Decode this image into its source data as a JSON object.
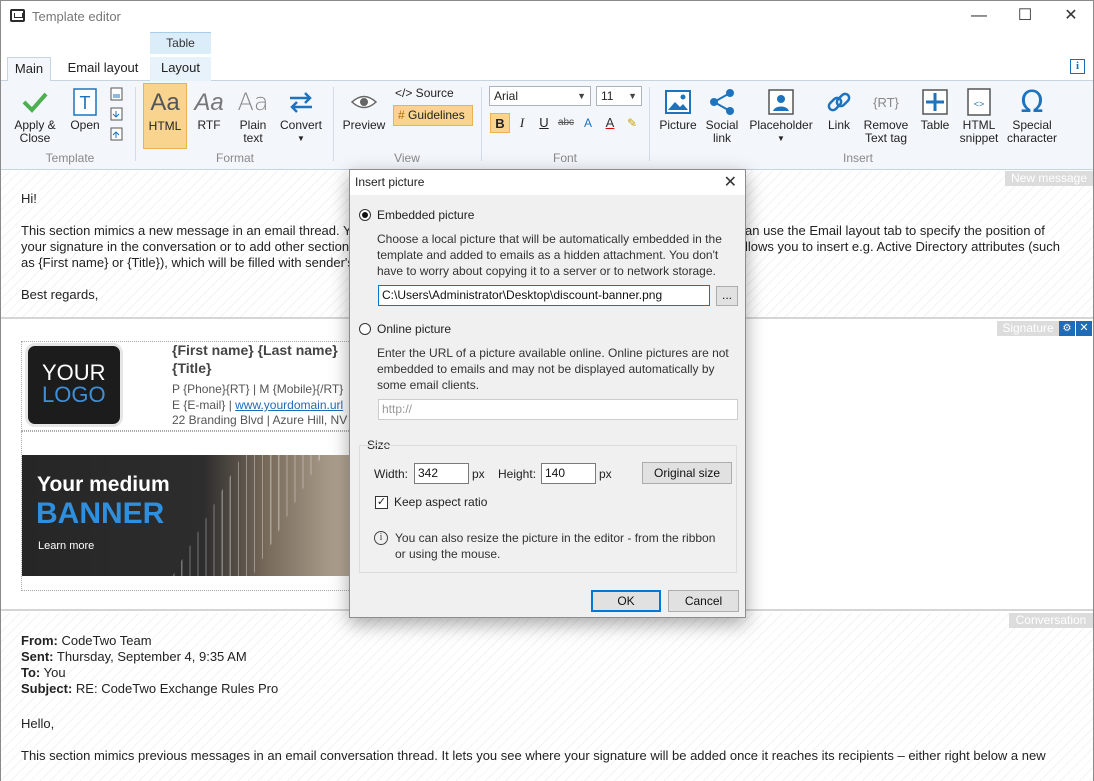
{
  "window": {
    "title": "Template editor",
    "minimize": "—",
    "maximize": "☐",
    "close": "✕"
  },
  "tabs": {
    "context_group": "Table",
    "items": [
      "Main",
      "Email layout",
      "Layout"
    ]
  },
  "ribbon": {
    "template": {
      "apply_close": [
        "Apply &",
        "Close"
      ],
      "open": "Open",
      "group": "Template"
    },
    "format": {
      "html": "HTML",
      "rtf": "RTF",
      "plain_text": [
        "Plain",
        "text"
      ],
      "convert": "Convert",
      "group": "Format"
    },
    "view": {
      "preview": "Preview",
      "source": "</> Source",
      "guidelines": "Guidelines",
      "group": "View"
    },
    "font": {
      "family": "Arial",
      "size": "11",
      "bold": "B",
      "italic": "I",
      "underline": "U",
      "strike": "abc",
      "group": "Font"
    },
    "insert": {
      "picture": "Picture",
      "social_link": [
        "Social",
        "link"
      ],
      "placeholder": "Placeholder",
      "link": "Link",
      "remove_text_tag": [
        "Remove",
        "Text tag"
      ],
      "table": "Table",
      "html_snippet": [
        "HTML",
        "snippet"
      ],
      "special_character": [
        "Special",
        "character"
      ],
      "group": "Insert"
    }
  },
  "new_message": {
    "tag": "New message",
    "greeting": "Hi!",
    "line1_left": "This section mimics a new message in an email thread. Y",
    "line1_right": "an use the Email layout tab to specify the position of",
    "line2_left": "your signature in the conversation or to add other section",
    "line2_right": "llows you to insert e.g. Active Directory attributes (such",
    "line3_left": "as {First name} or {Title}), which will be filled with sender's",
    "closing": "Best regards,"
  },
  "signature": {
    "tag": "Signature",
    "logo_line1": "YOUR",
    "logo_line2": "LOGO",
    "name": "{First name} {Last name}",
    "title": "{Title}",
    "phone_line": "P {Phone}{RT} | M {Mobile}{/RT}",
    "email_prefix": "E {E-mail} | ",
    "domain": "www.yourdomain.url",
    "address": "22 Branding Blvd | Azure Hill, NV",
    "banner_line1": "Your medium",
    "banner_line2": "BANNER",
    "banner_cta": "Learn more"
  },
  "conversation": {
    "tag": "Conversation",
    "from_label": "From:",
    "from": " CodeTwo Team",
    "sent_label": "Sent:",
    "sent": " Thursday, September 4, 9:35 AM",
    "to_label": "To:",
    "to": " You",
    "subject_label": "Subject:",
    "subject": " RE: CodeTwo Exchange Rules Pro",
    "hello": "Hello,",
    "body": "This section mimics previous messages in an email conversation thread. It lets you see where your signature will be added once it reaches its recipients – either right below a new"
  },
  "dialog": {
    "title": "Insert picture",
    "embedded_label": "Embedded picture",
    "embedded_desc": [
      "Choose a local picture that will be automatically embedded in the",
      "template and added to emails as a hidden attachment. You don't",
      "have to worry about copying it to a server or to network storage."
    ],
    "path_value": "C:\\Users\\Administrator\\Desktop\\discount-banner.png",
    "browse": "...",
    "online_label": "Online picture",
    "online_desc": [
      "Enter the URL of a picture available online. Online pictures are not",
      "embedded to emails and may not be displayed automatically by",
      "some email clients."
    ],
    "url_placeholder": "http://",
    "size_group": "Size",
    "width_label": "Width:",
    "width": "342",
    "px": "px",
    "height_label": "Height:",
    "height": "140",
    "original_size": "Original size",
    "keep_aspect": "Keep aspect ratio",
    "hint": [
      "You can also resize the picture in the editor - from the ribbon",
      "or using the mouse."
    ],
    "ok": "OK",
    "cancel": "Cancel"
  }
}
